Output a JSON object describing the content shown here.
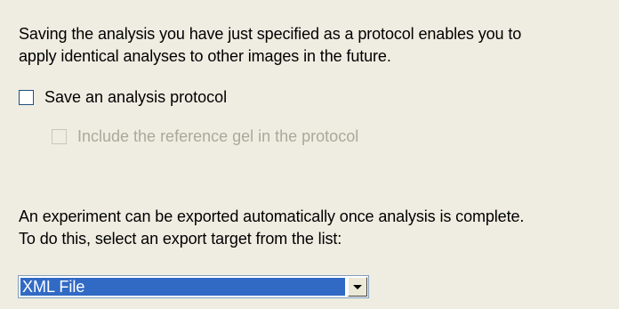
{
  "protocol_section": {
    "intro_lines": [
      "Saving the analysis you have just specified as a protocol enables you to",
      "apply identical analyses to other images in the future."
    ],
    "save_protocol_checkbox": {
      "label": "Save an analysis protocol",
      "checked": false,
      "enabled": true
    },
    "include_reference_checkbox": {
      "label": "Include the reference gel in the protocol",
      "checked": false,
      "enabled": false
    }
  },
  "export_section": {
    "text_lines": [
      "An experiment can be exported automatically once analysis is complete.",
      "To do this, select an export target from the list:"
    ],
    "export_target_select": {
      "selected": "XML File"
    }
  },
  "colors": {
    "background": "#efede2",
    "selection_highlight": "#316ac5",
    "disabled_text": "#aca899"
  }
}
